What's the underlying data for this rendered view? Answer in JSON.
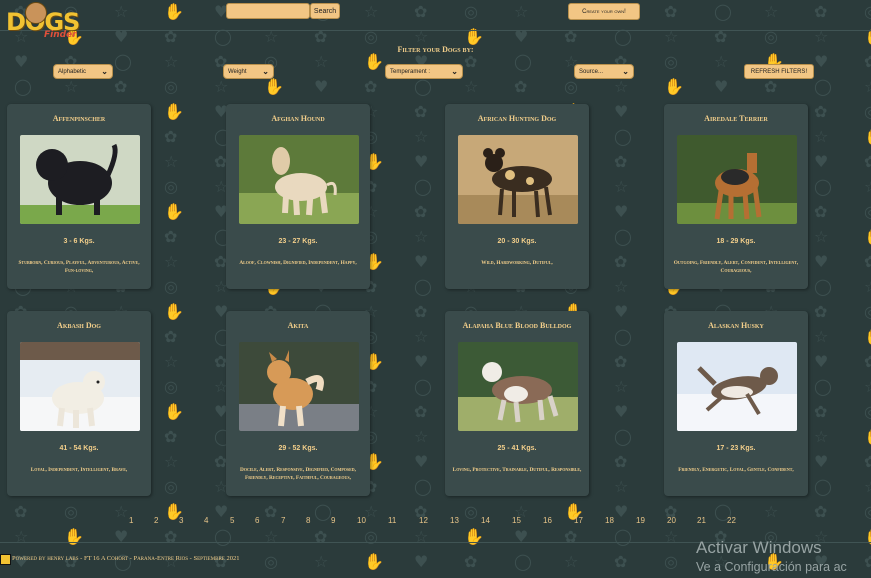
{
  "header": {
    "logo_text": "DOGS",
    "logo_sub": "Finder",
    "search_placeholder": "",
    "search_value": "",
    "search_label": "Search",
    "create_label": "Create your own!"
  },
  "filters": {
    "title": "Filter your Dogs by:",
    "alphabetic": "Alphabetic",
    "weight": "Weight",
    "temperament": "Temperament :",
    "source": "Source...",
    "refresh_label": "REFRESH FILTERS!"
  },
  "cards": [
    {
      "name": "Affenpinscher",
      "weight": "3 - 6 Kgs.",
      "temperament": "Stubborn, Curious, Playful, Adventurous, Active, Fun-loving,"
    },
    {
      "name": "Afghan Hound",
      "weight": "23 - 27 Kgs.",
      "temperament": "Aloof, Clownish, Dignified, Independent, Happy,"
    },
    {
      "name": "African Hunting Dog",
      "weight": "20 - 30 Kgs.",
      "temperament": "Wild, Hardworking, Dutiful,"
    },
    {
      "name": "Airedale Terrier",
      "weight": "18 - 29 Kgs.",
      "temperament": "Outgoing, Friendly, Alert, Confident, Intelligent, Courageous,"
    },
    {
      "name": "Akbash Dog",
      "weight": "41 - 54 Kgs.",
      "temperament": "Loyal, Independent, Intelligent, Brave,"
    },
    {
      "name": "Akita",
      "weight": "29 - 52 Kgs.",
      "temperament": "Docile, Alert, Responsive, Dignified, Composed, Friendly, Receptive, Faithful, Courageous,"
    },
    {
      "name": "Alapaha Blue Blood Bulldog",
      "weight": "25 - 41 Kgs.",
      "temperament": "Loving, Protective, Trainable, Dutiful, Responsible,"
    },
    {
      "name": "Alaskan Husky",
      "weight": "17 - 23 Kgs.",
      "temperament": "Friendly, Energetic, Loyal, Gentle, Confident,"
    }
  ],
  "pagination": [
    "1",
    "2",
    "3",
    "4",
    "5",
    "6",
    "7",
    "8",
    "9",
    "10",
    "11",
    "12",
    "13",
    "14",
    "15",
    "16",
    "17",
    "18",
    "19",
    "20",
    "21",
    "22"
  ],
  "footer": {
    "text": "Powered by henry labs - FT 16 A Cohort - Parana-Entre Rios - Septiembre 2021"
  },
  "watermark": {
    "line1": "Activar Windows",
    "line2": "Ve a Configuración para ac"
  },
  "colors": {
    "background": "#2b3b3b",
    "card": "#3a4b4b",
    "accent": "#f2c684",
    "text": "#f3cf8b"
  }
}
